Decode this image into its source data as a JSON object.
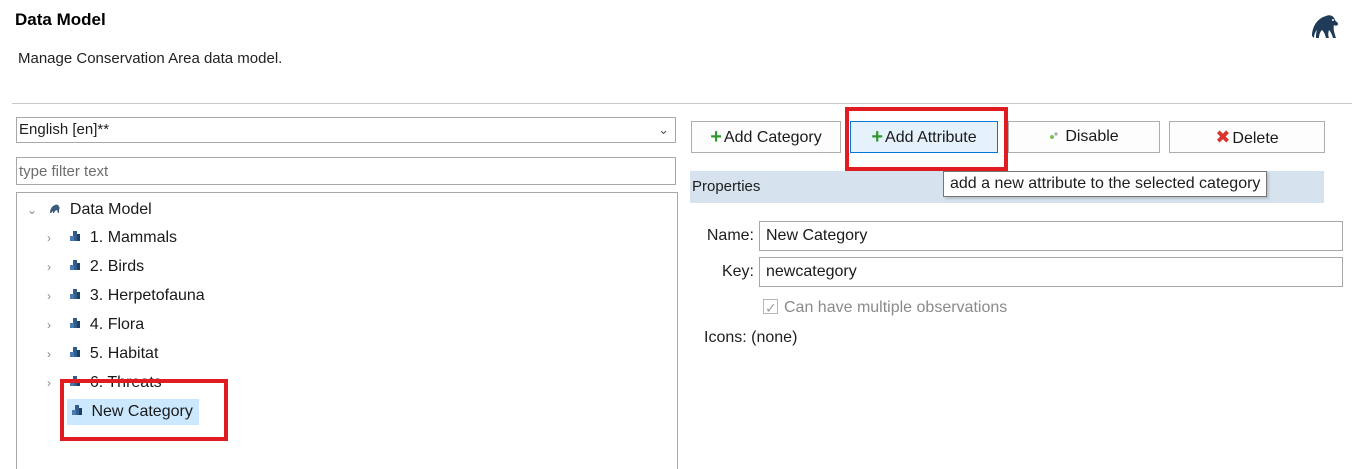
{
  "header": {
    "title": "Data Model",
    "description": "Manage Conservation Area data model.",
    "logo_icon": "panther-logo-icon"
  },
  "left": {
    "language_select": {
      "value": "English [en]**",
      "caret_icon": "chevron-down-icon"
    },
    "filter": {
      "placeholder": "type filter text",
      "value": ""
    },
    "tree": {
      "root": {
        "label": "Data Model",
        "expanded": true,
        "icon": "panther-icon"
      },
      "items": [
        {
          "label": "1. Mammals",
          "expandable": true,
          "icon": "category-icon"
        },
        {
          "label": "2. Birds",
          "expandable": true,
          "icon": "category-icon"
        },
        {
          "label": "3. Herpetofauna",
          "expandable": true,
          "icon": "category-icon"
        },
        {
          "label": "4. Flora",
          "expandable": true,
          "icon": "category-icon"
        },
        {
          "label": "5. Habitat",
          "expandable": true,
          "icon": "category-icon"
        },
        {
          "label": "6. Threats",
          "expandable": true,
          "icon": "category-icon"
        },
        {
          "label": "New Category",
          "expandable": false,
          "icon": "category-icon",
          "selected": true
        }
      ]
    }
  },
  "toolbar": {
    "add_category": "Add Category",
    "add_attribute": "Add Attribute",
    "disable": "Disable",
    "delete": "Delete"
  },
  "tooltip": "add a new attribute to the selected category",
  "properties": {
    "header": "Properties",
    "name_label": "Name:",
    "name_value": "New Category",
    "key_label": "Key:",
    "key_value": "newcategory",
    "multiple_obs_label": "Can have multiple observations",
    "multiple_obs_checked": true,
    "icons_label": "Icons:",
    "icons_value": "(none)"
  },
  "colors": {
    "highlight": "#e01b22",
    "selection": "#cce8ff",
    "properties_bar": "#d6e3ee",
    "add_green": "#2e9a2e",
    "delete_red": "#d9332b"
  }
}
